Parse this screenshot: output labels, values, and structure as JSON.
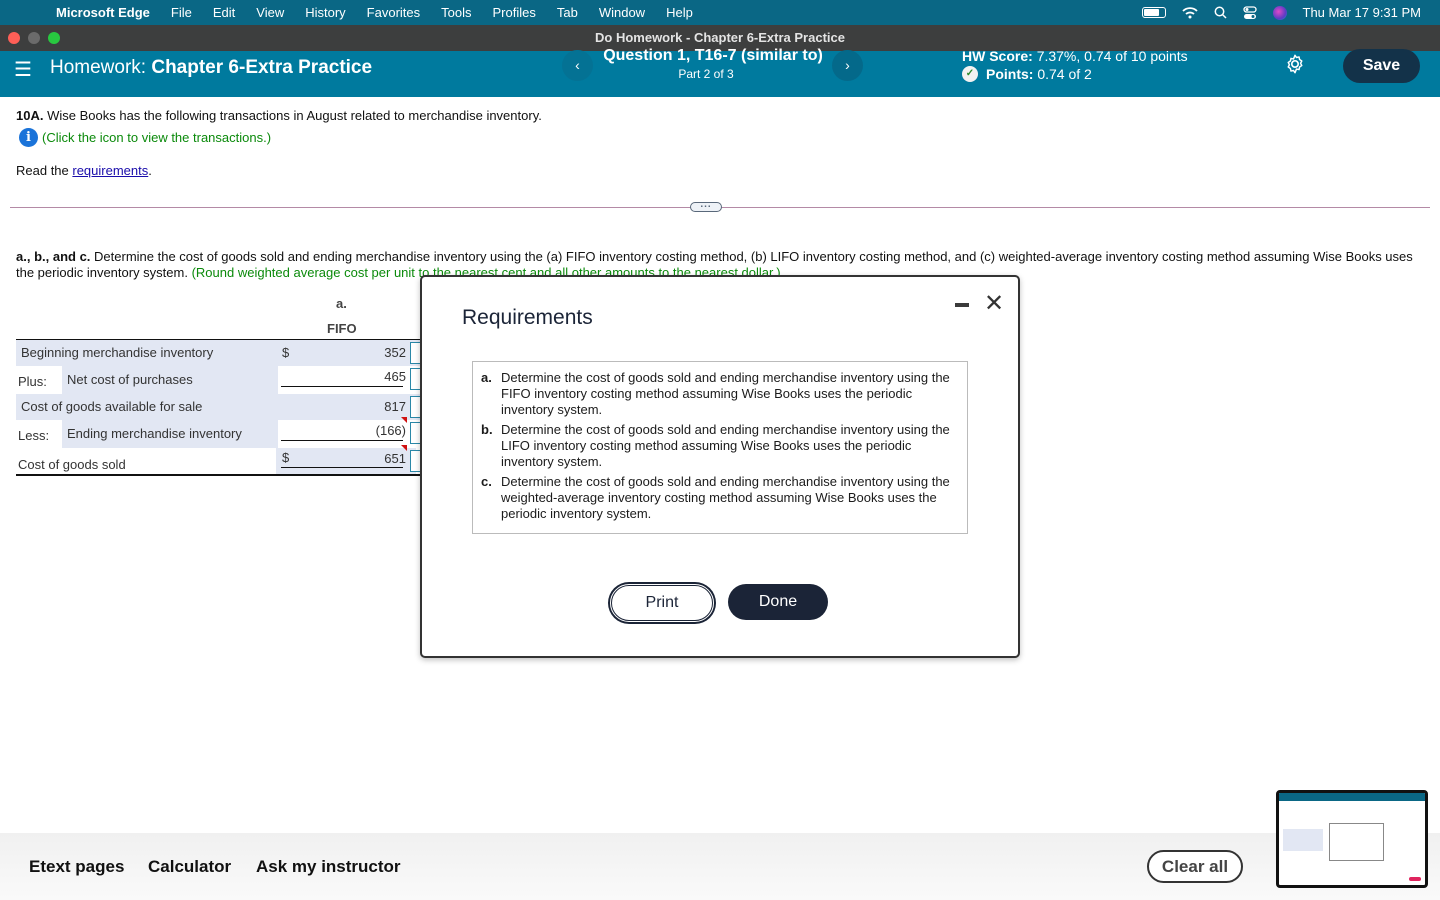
{
  "menubar": {
    "app_name": "Microsoft Edge",
    "menus": [
      "File",
      "Edit",
      "View",
      "History",
      "Favorites",
      "Tools",
      "Profiles",
      "Tab",
      "Window",
      "Help"
    ],
    "clock": "Thu Mar 17  9:31 PM"
  },
  "window": {
    "title": "Do Homework - Chapter 6-Extra Practice"
  },
  "header": {
    "hw_prefix": "Homework:",
    "hw_name": "Chapter 6-Extra Practice",
    "question_title": "Question 1, T16-7 (similar to)",
    "question_part": "Part 2 of 3",
    "prev_label": "‹",
    "next_label": "›",
    "score_label": "HW Score:",
    "score_value": "7.37%, 0.74 of 10 points",
    "points_label": "Points:",
    "points_value": "0.74 of 2",
    "save_label": "Save"
  },
  "question": {
    "intro_bold": "10A.",
    "intro_text": "Wise Books has the following transactions in August related to merchandise inventory.",
    "info_link": "(Click the icon to view the transactions.)",
    "read_prefix": "Read the ",
    "requirements_link": "requirements",
    "read_suffix": ".",
    "task_bold": "a., b., and c.",
    "task_text": "Determine the cost of goods sold and ending merchandise inventory using the (a) FIFO inventory costing method, (b) LIFO inventory costing method, and (c) weighted-average inventory costing method assuming Wise Books uses the periodic inventory system.",
    "task_hint": "(Round weighted average cost per unit to the nearest cent and all other amounts to the nearest dollar.)"
  },
  "table": {
    "col_letter": "a.",
    "col_header": "FIFO",
    "rows": [
      {
        "prefix": "",
        "label": "Beginning merchandise inventory",
        "dollar": "$",
        "value": "352"
      },
      {
        "prefix": "Plus:",
        "label": "Net cost of purchases",
        "dollar": "",
        "value": "465"
      },
      {
        "prefix": "",
        "label": "Cost of goods available for sale",
        "dollar": "",
        "value": "817"
      },
      {
        "prefix": "Less:",
        "label": "Ending merchandise inventory",
        "dollar": "",
        "value": "(166)"
      },
      {
        "prefix": "",
        "label": "Cost of goods sold",
        "dollar": "$",
        "value": "651"
      }
    ]
  },
  "modal": {
    "title": "Requirements",
    "items": [
      {
        "key": "a.",
        "text": "Determine the cost of goods sold and ending merchandise inventory using the FIFO inventory costing method assuming Wise Books uses the periodic inventory system."
      },
      {
        "key": "b.",
        "text": "Determine the cost of goods sold and ending merchandise inventory using the LIFO inventory costing method assuming Wise Books uses the periodic inventory system."
      },
      {
        "key": "c.",
        "text": "Determine the cost of goods sold and ending merchandise inventory using the weighted-average inventory costing method assuming Wise Books uses the periodic inventory system."
      }
    ],
    "print_label": "Print",
    "done_label": "Done"
  },
  "footer": {
    "links": [
      "Etext pages",
      "Calculator",
      "Ask my instructor"
    ],
    "clear_label": "Clear all"
  },
  "colors": {
    "header_bg": "#007a9e",
    "menubar_bg": "#0a6785",
    "save_bg": "#133249",
    "hint_green": "#0b8a0b",
    "table_highlight": "#e2e7f3"
  }
}
